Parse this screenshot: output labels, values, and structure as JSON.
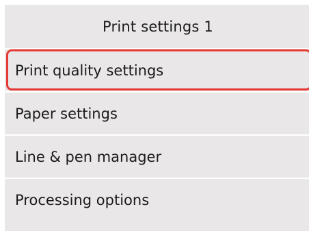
{
  "header": {
    "title": "Print settings 1"
  },
  "menu": {
    "items": [
      {
        "label": "Print quality settings",
        "selected": true
      },
      {
        "label": "Paper settings",
        "selected": false
      },
      {
        "label": "Line & pen manager",
        "selected": false
      },
      {
        "label": "Processing options",
        "selected": false
      }
    ]
  },
  "colors": {
    "screen_background": "#e9e7e8",
    "divider": "#ffffff",
    "selection_border": "#e53a33",
    "text": "#1a1a1a"
  }
}
